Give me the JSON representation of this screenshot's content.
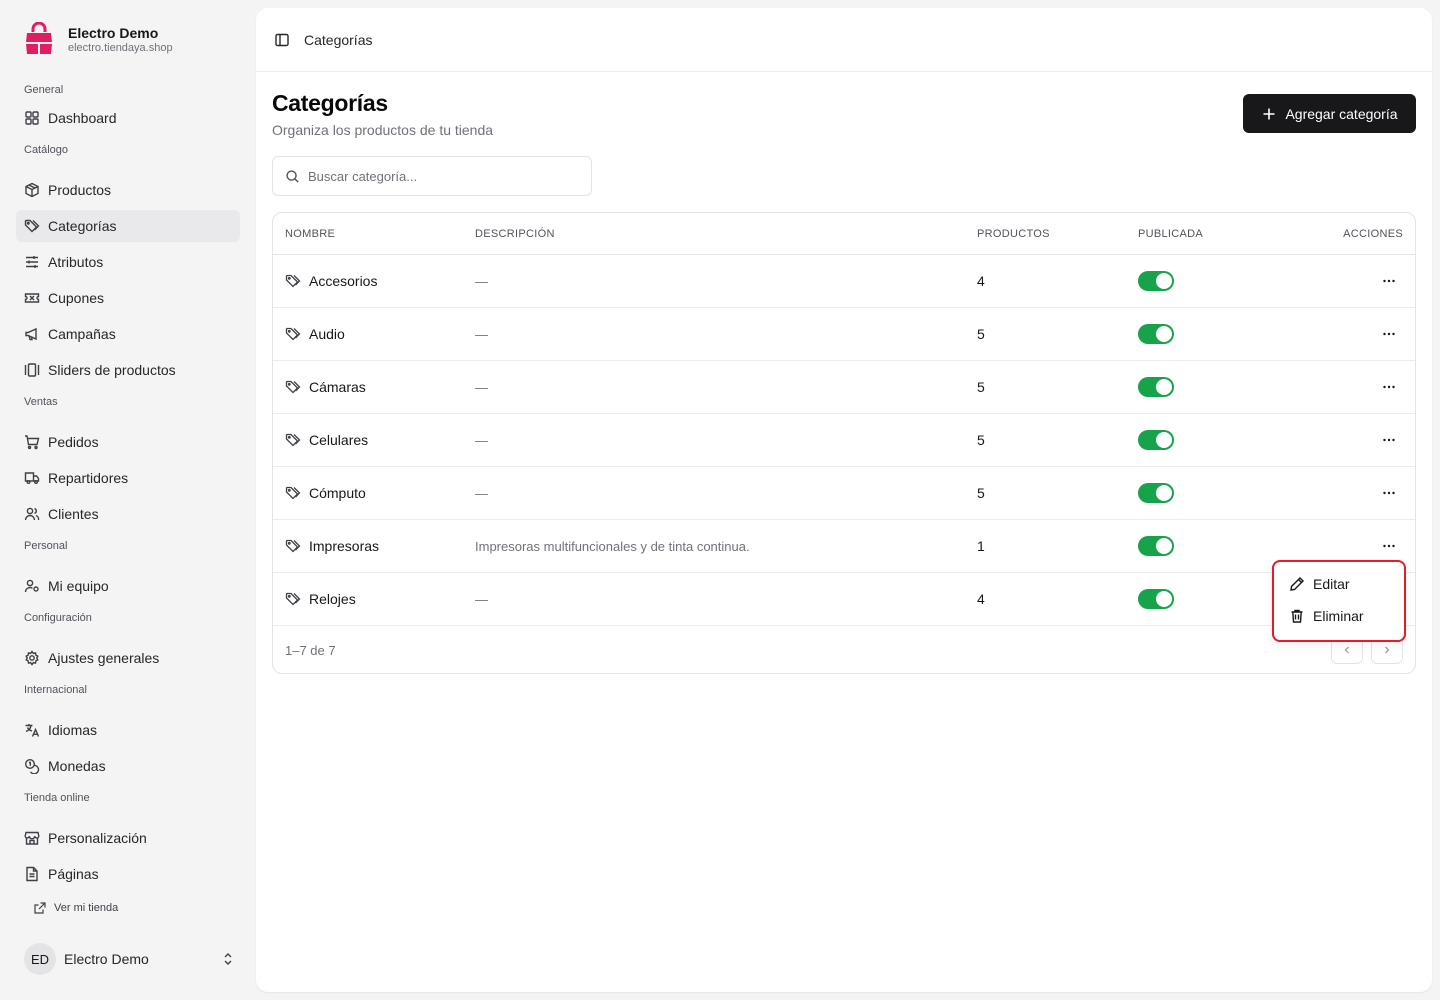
{
  "brand": {
    "name": "Electro Demo",
    "url": "electro.tiendaya.shop",
    "logo_icon": "shopping-bag-icon",
    "color": "#e11d63"
  },
  "nav": {
    "groups": [
      {
        "label": "General",
        "items": [
          {
            "label": "Dashboard",
            "icon": "dashboard-icon"
          }
        ]
      },
      {
        "label": "Catálogo",
        "items": [
          {
            "label": "Productos",
            "icon": "package-icon"
          },
          {
            "label": "Categorías",
            "icon": "tag-icon",
            "active": true
          },
          {
            "label": "Atributos",
            "icon": "sliders-icon"
          },
          {
            "label": "Cupones",
            "icon": "ticket-icon"
          },
          {
            "label": "Campañas",
            "icon": "megaphone-icon"
          },
          {
            "label": "Sliders de productos",
            "icon": "gallery-icon"
          }
        ]
      },
      {
        "label": "Ventas",
        "items": [
          {
            "label": "Pedidos",
            "icon": "cart-icon"
          },
          {
            "label": "Repartidores",
            "icon": "truck-icon"
          },
          {
            "label": "Clientes",
            "icon": "users-icon"
          }
        ]
      },
      {
        "label": "Personal",
        "items": [
          {
            "label": "Mi equipo",
            "icon": "user-key-icon"
          }
        ]
      },
      {
        "label": "Configuración",
        "items": [
          {
            "label": "Ajustes generales",
            "icon": "gear-icon"
          }
        ]
      },
      {
        "label": "Internacional",
        "items": [
          {
            "label": "Idiomas",
            "icon": "translate-icon"
          },
          {
            "label": "Monedas",
            "icon": "coins-icon"
          }
        ]
      },
      {
        "label": "Tienda online",
        "items": [
          {
            "label": "Personalización",
            "icon": "store-icon"
          },
          {
            "label": "Páginas",
            "icon": "file-icon"
          }
        ]
      }
    ],
    "store_link": "Ver mi tienda"
  },
  "user": {
    "initials": "ED",
    "name": "Electro Demo"
  },
  "topbar": {
    "breadcrumb": "Categorías"
  },
  "page": {
    "title": "Categorías",
    "subtitle": "Organiza los productos de tu tienda",
    "add_button": "Agregar categoría",
    "search_placeholder": "Buscar categoría..."
  },
  "table": {
    "headers": {
      "name": "NOMBRE",
      "description": "DESCRIPCIÓN",
      "products": "PRODUCTOS",
      "published": "PUBLICADA",
      "actions": "ACCIONES"
    },
    "rows": [
      {
        "name": "Accesorios",
        "description": "—",
        "products": "4",
        "published": true
      },
      {
        "name": "Audio",
        "description": "—",
        "products": "5",
        "published": true
      },
      {
        "name": "Cámaras",
        "description": "—",
        "products": "5",
        "published": true
      },
      {
        "name": "Celulares",
        "description": "—",
        "products": "5",
        "published": true
      },
      {
        "name": "Cómputo",
        "description": "—",
        "products": "5",
        "published": true
      },
      {
        "name": "Impresoras",
        "description": "Impresoras multifuncionales y de tinta continua.",
        "products": "1",
        "published": true
      },
      {
        "name": "Relojes",
        "description": "—",
        "products": "4",
        "published": true
      }
    ],
    "footer": "1–7 de 7"
  },
  "menu": {
    "edit": "Editar",
    "delete": "Eliminar"
  },
  "colors": {
    "toggle_on": "#16a34a",
    "primary": "#18181b",
    "highlight": "#e11d2a"
  }
}
